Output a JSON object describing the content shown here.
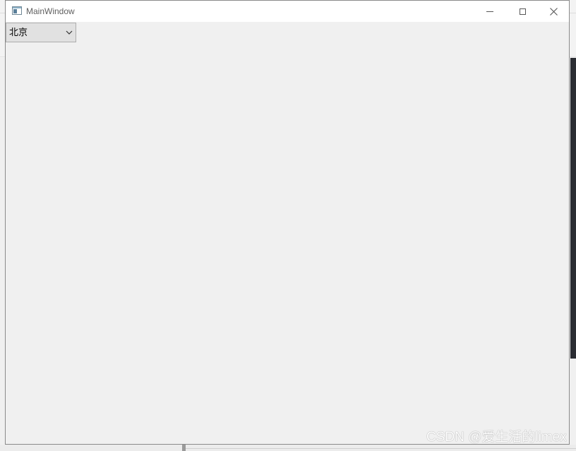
{
  "window": {
    "title": "MainWindow"
  },
  "titlebar_buttons": {
    "minimize_icon": "minimize-icon",
    "maximize_icon": "maximize-icon",
    "close_icon": "close-icon"
  },
  "combo": {
    "selected": "北京"
  },
  "watermark": {
    "text": "CSDN @爱生活的limex"
  },
  "colors": {
    "titlebar": "#ffffff",
    "client": "#f0f0f0",
    "combo_bg": "#e1e1e1"
  }
}
